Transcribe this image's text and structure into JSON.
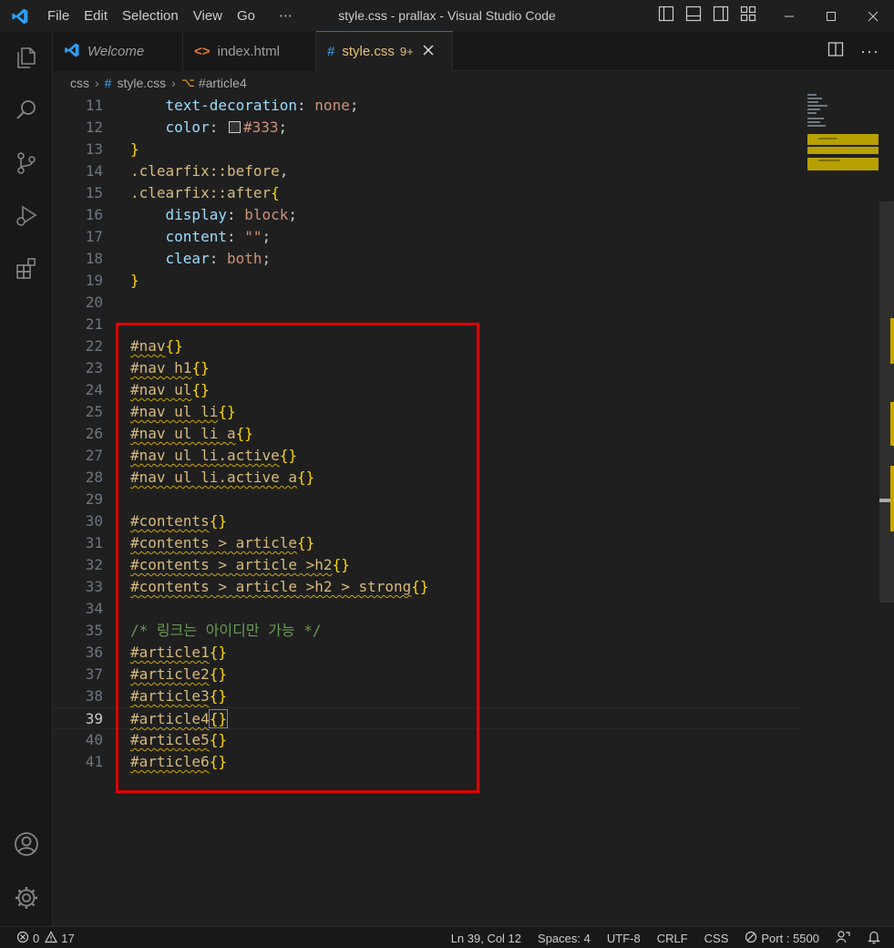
{
  "window": {
    "title": "style.css - prallax - Visual Studio Code",
    "menu": [
      "File",
      "Edit",
      "Selection",
      "View",
      "Go",
      "⋯"
    ]
  },
  "tabs": [
    {
      "label": "Welcome",
      "icon": "vscode-icon"
    },
    {
      "label": "index.html",
      "icon": "html-icon"
    },
    {
      "label": "style.css",
      "badge": "9+",
      "icon": "css-hash-icon",
      "active": true
    }
  ],
  "breadcrumbs": [
    "css",
    "style.css",
    "#article4"
  ],
  "editor": {
    "lines": [
      {
        "num": "11",
        "code": "    text-decoration: none;"
      },
      {
        "num": "12",
        "code": "    color: #333;"
      },
      {
        "num": "13",
        "code": "}"
      },
      {
        "num": "14",
        "code": ".clearfix::before,"
      },
      {
        "num": "15",
        "code": ".clearfix::after{"
      },
      {
        "num": "16",
        "code": "    display: block;"
      },
      {
        "num": "17",
        "code": "    content: \"\";"
      },
      {
        "num": "18",
        "code": "    clear: both;"
      },
      {
        "num": "19",
        "code": "}"
      },
      {
        "num": "20",
        "code": ""
      },
      {
        "num": "21",
        "code": ""
      },
      {
        "num": "22",
        "code": "#nav{}"
      },
      {
        "num": "23",
        "code": "#nav h1{}"
      },
      {
        "num": "24",
        "code": "#nav ul{}"
      },
      {
        "num": "25",
        "code": "#nav ul li{}"
      },
      {
        "num": "26",
        "code": "#nav ul li a{}"
      },
      {
        "num": "27",
        "code": "#nav ul li.active{}"
      },
      {
        "num": "28",
        "code": "#nav ul li.active a{}"
      },
      {
        "num": "29",
        "code": ""
      },
      {
        "num": "30",
        "code": "#contents{}"
      },
      {
        "num": "31",
        "code": "#contents > article{}"
      },
      {
        "num": "32",
        "code": "#contents > article >h2{}"
      },
      {
        "num": "33",
        "code": "#contents > article >h2 > strong{}"
      },
      {
        "num": "34",
        "code": ""
      },
      {
        "num": "35",
        "code": "/* 링크는 아이디만 가능 */"
      },
      {
        "num": "36",
        "code": "#article1{}"
      },
      {
        "num": "37",
        "code": "#article2{}"
      },
      {
        "num": "38",
        "code": "#article3{}"
      },
      {
        "num": "39",
        "code": "#article4{}",
        "current": true
      },
      {
        "num": "40",
        "code": "#article5{}"
      },
      {
        "num": "41",
        "code": "#article6{}"
      }
    ]
  },
  "statusbar": {
    "errors": "0",
    "warnings": "17",
    "position": "Ln 39, Col 12",
    "spaces": "Spaces: 4",
    "encoding": "UTF-8",
    "eol": "CRLF",
    "language": "CSS",
    "port": "Port : 5500"
  },
  "colors": {
    "accent": "#0078d4",
    "highlight_box": "#e00000",
    "selector": "#d7ba7d",
    "brace": "#ffd700",
    "property": "#9cdcfe",
    "value": "#ce9178",
    "comment": "#6a9955"
  }
}
